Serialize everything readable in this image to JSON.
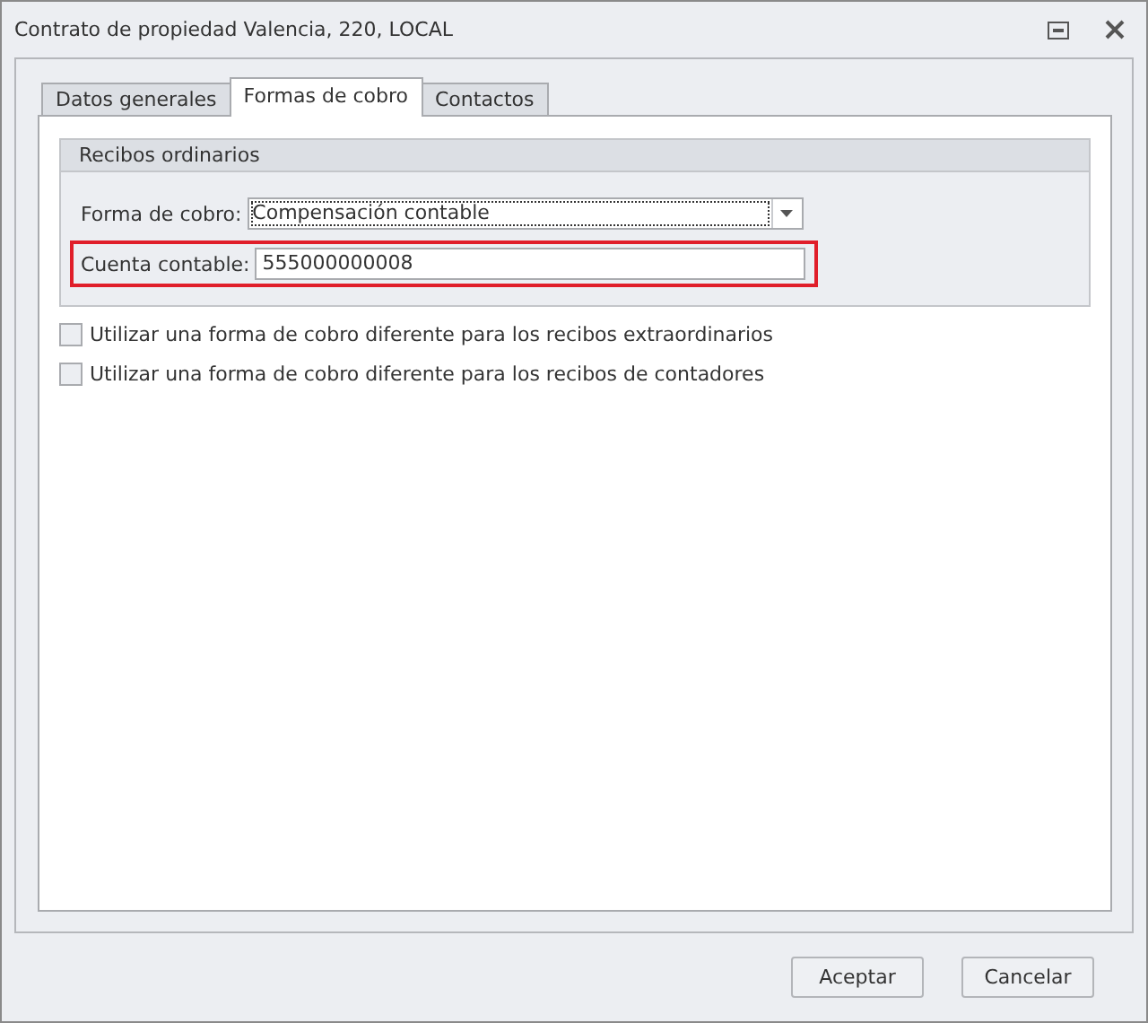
{
  "window": {
    "title": "Contrato de propiedad Valencia, 220, LOCAL"
  },
  "tabs": [
    {
      "label": "Datos generales",
      "selected": false
    },
    {
      "label": "Formas de cobro",
      "selected": true
    },
    {
      "label": "Contactos",
      "selected": false
    }
  ],
  "group": {
    "title": "Recibos ordinarios",
    "fields": [
      {
        "kind": "combo",
        "label": "Forma de cobro:",
        "value": "Compensación contable",
        "highlighted": false
      },
      {
        "kind": "text",
        "label": "Cuenta contable:",
        "value": "555000000008",
        "highlighted": true
      }
    ]
  },
  "checkboxes": [
    {
      "label": "Utilizar una forma de cobro diferente para los recibos extraordinarios",
      "checked": false
    },
    {
      "label": "Utilizar una forma de cobro diferente para los recibos de contadores",
      "checked": false
    }
  ],
  "buttons": [
    "Aceptar",
    "Cancelar"
  ]
}
